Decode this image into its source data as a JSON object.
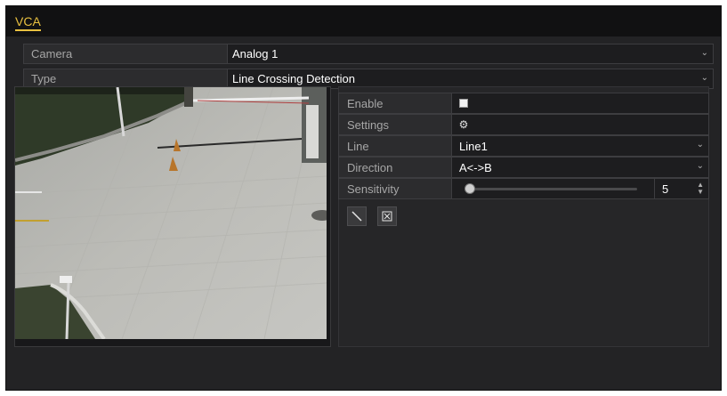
{
  "tab": {
    "label": "VCA"
  },
  "camera": {
    "label": "Camera",
    "value": "Analog 1"
  },
  "type": {
    "label": "Type",
    "value": "Line Crossing Detection"
  },
  "panel": {
    "enable": {
      "label": "Enable",
      "checked": false
    },
    "settings": {
      "label": "Settings",
      "icon": "gear-icon"
    },
    "line": {
      "label": "Line",
      "value": "Line1"
    },
    "direction": {
      "label": "Direction",
      "value": "A<->B"
    },
    "sensitivity": {
      "label": "Sensitivity",
      "value": "5"
    }
  },
  "toolbar": {
    "draw_icon": "draw-line-icon",
    "clear_icon": "clear-icon"
  },
  "colors": {
    "accent": "#e8c040",
    "background": "#232325",
    "field": "#1d1d1f"
  }
}
